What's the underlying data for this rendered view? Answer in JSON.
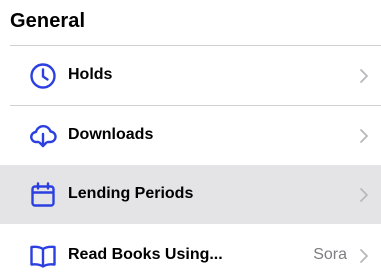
{
  "section": {
    "title": "General"
  },
  "colors": {
    "accent": "#2c3fe0",
    "chevron": "#b8b8bd",
    "highlight_row": "#e4e4e7",
    "divider": "#cfcfd4",
    "secondary_text": "#7d7d82"
  },
  "items": [
    {
      "label": "Holds",
      "icon": "clock-icon",
      "value": ""
    },
    {
      "label": "Downloads",
      "icon": "cloud-download-icon",
      "value": ""
    },
    {
      "label": "Lending Periods",
      "icon": "calendar-icon",
      "value": "",
      "highlighted": true
    },
    {
      "label": "Read Books Using...",
      "icon": "open-book-icon",
      "value": "Sora"
    }
  ]
}
